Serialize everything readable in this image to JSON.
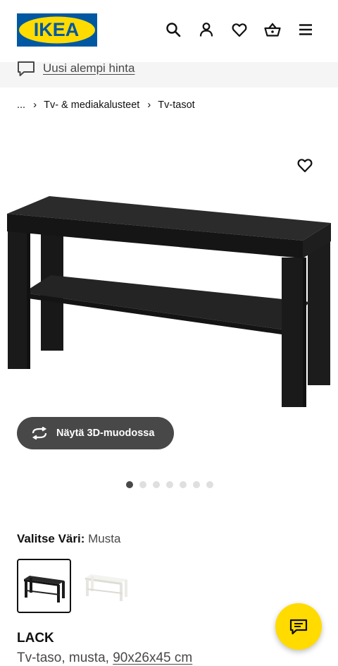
{
  "header": {
    "logo_text": "IKEA",
    "icons": [
      "search-icon",
      "account-icon",
      "heart-icon",
      "basket-icon",
      "menu-icon"
    ]
  },
  "promo": {
    "icon": "chat-bubble-icon",
    "text": "Uusi alempi hinta"
  },
  "breadcrumb": {
    "ellipsis": "...",
    "separator": "›",
    "items": [
      "Tv- & mediakalusteet",
      "Tv-tasot"
    ]
  },
  "gallery": {
    "favorite_icon": "heart-icon",
    "button_3d": "Näytä 3D-muodossa",
    "button_3d_icon": "rotate-arrows-icon",
    "slide_count": 7,
    "active_slide": 1
  },
  "color_selector": {
    "label": "Valitse Väri:",
    "value": "Musta",
    "options": [
      "black",
      "white"
    ]
  },
  "product": {
    "name": "LACK",
    "description": "Tv-taso, musta,",
    "dimensions": "90x26x45 cm"
  },
  "chat": {
    "icon": "chat-icon"
  },
  "colors": {
    "brand_blue": "#0058a3",
    "brand_yellow": "#ffdb00",
    "button_dark": "#484848",
    "promo_bg": "#f5f5f5"
  }
}
